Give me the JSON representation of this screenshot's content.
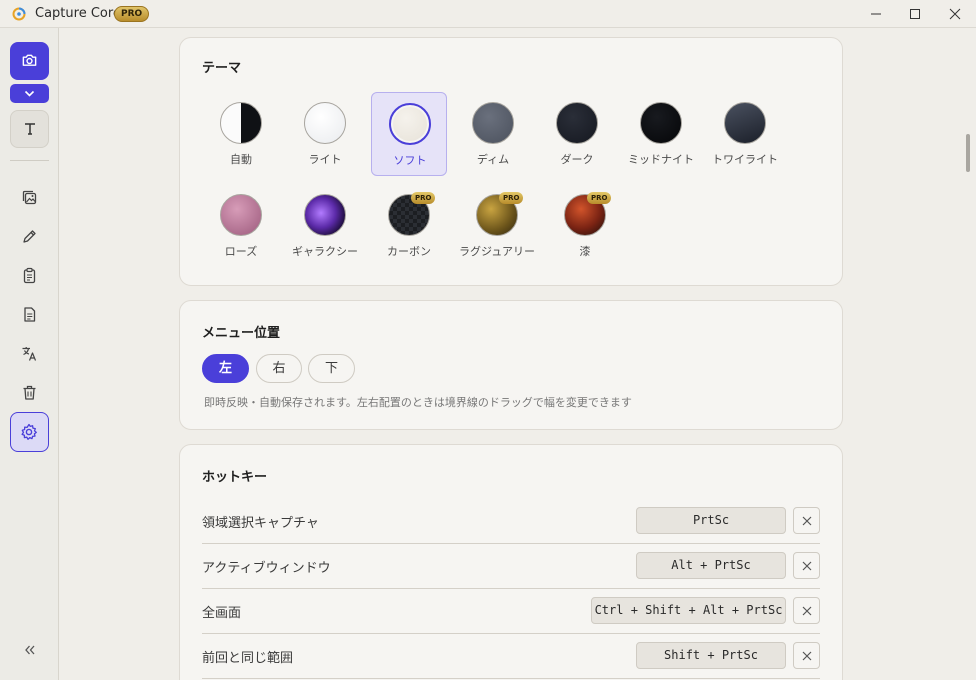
{
  "window": {
    "title": "Capture Core",
    "badge": "PRO",
    "controls": {
      "minimize_icon": "minimize-icon",
      "maximize_icon": "maximize-icon",
      "close_icon": "close-icon"
    }
  },
  "sidebar": {
    "items": [
      {
        "name": "capture",
        "icon": "camera-icon",
        "active": true
      },
      {
        "name": "capture-mode-dropdown",
        "icon": "chevron-down-icon"
      },
      {
        "name": "text",
        "icon": "text-icon"
      },
      {
        "name": "image-edit",
        "icon": "image-stack-icon"
      },
      {
        "name": "draw",
        "icon": "pen-icon"
      },
      {
        "name": "clipboard",
        "icon": "clipboard-icon"
      },
      {
        "name": "document",
        "icon": "document-icon"
      },
      {
        "name": "translate",
        "icon": "translate-icon"
      },
      {
        "name": "trash",
        "icon": "trash-icon"
      },
      {
        "name": "settings",
        "icon": "gear-icon",
        "selected": true
      }
    ],
    "collapse_icon": "double-chevron-left-icon"
  },
  "theme": {
    "title": "テーマ",
    "selected": "ソフト",
    "options": [
      {
        "label": "自動",
        "pro": false
      },
      {
        "label": "ライト",
        "pro": false
      },
      {
        "label": "ソフト",
        "pro": false
      },
      {
        "label": "ディム",
        "pro": false
      },
      {
        "label": "ダーク",
        "pro": false
      },
      {
        "label": "ミッドナイト",
        "pro": false
      },
      {
        "label": "トワイライト",
        "pro": false
      },
      {
        "label": "ローズ",
        "pro": false
      },
      {
        "label": "ギャラクシー",
        "pro": false
      },
      {
        "label": "カーボン",
        "pro": true,
        "badge": "PRO"
      },
      {
        "label": "ラグジュアリー",
        "pro": true,
        "badge": "PRO"
      },
      {
        "label": "漆",
        "pro": true,
        "badge": "PRO"
      }
    ]
  },
  "menu_position": {
    "title": "メニュー位置",
    "options": [
      "左",
      "右",
      "下"
    ],
    "selected": "左",
    "hint": "即時反映・自動保存されます。左右配置のときは境界線のドラッグで幅を変更できます"
  },
  "hotkeys": {
    "title": "ホットキー",
    "rows": [
      {
        "label": "領域選択キャプチャ",
        "key": "PrtSc"
      },
      {
        "label": "アクティブウィンドウ",
        "key": "Alt + PrtSc"
      },
      {
        "label": "全画面",
        "key": "Ctrl + Shift + Alt + PrtSc"
      },
      {
        "label": "前回と同じ範囲",
        "key": "Shift + PrtSc"
      }
    ],
    "clear_icon": "x-icon"
  },
  "colors": {
    "accent": "#4a3fd9",
    "background": "#f0eee9",
    "card": "#f6f5f2",
    "pro_gold": "#c9a441"
  }
}
